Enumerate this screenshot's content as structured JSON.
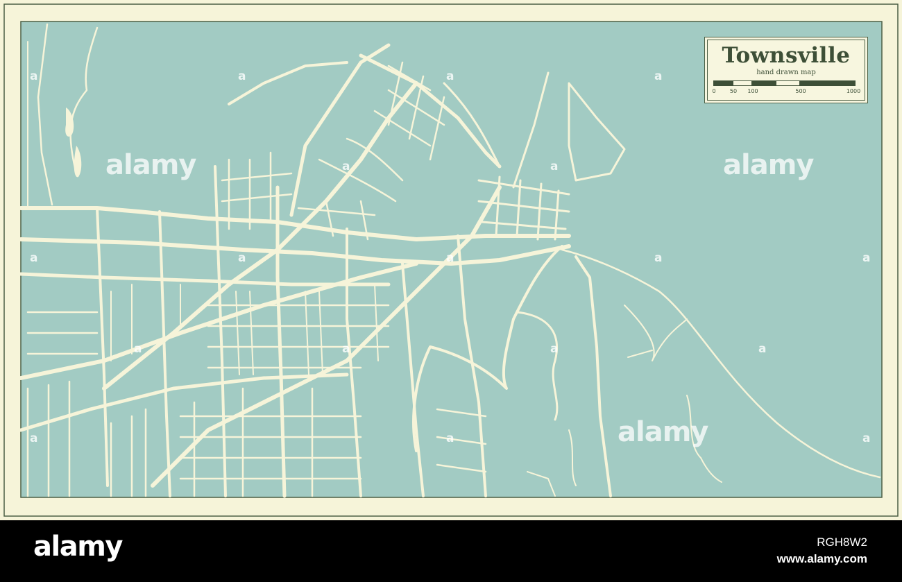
{
  "map": {
    "title": "Townsville",
    "subtitle": "hand drawn map",
    "scale_labels": [
      "0",
      "50",
      "100",
      "500",
      "1000"
    ],
    "colors": {
      "water": "#a2cbc3",
      "land": "#a2cbc3",
      "roads": "#f6f4d9",
      "frame": "#f6f4d9",
      "border": "#4c5f45",
      "text": "#3d4f37"
    }
  },
  "watermarks": {
    "brand": "alamy",
    "mark": "a"
  },
  "footer": {
    "logo": "alamy",
    "image_id": "RGH8W2",
    "url": "www.alamy.com"
  }
}
